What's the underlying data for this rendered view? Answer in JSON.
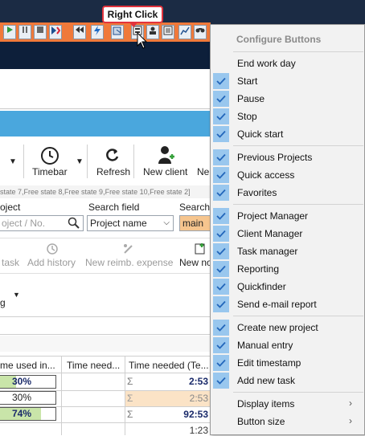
{
  "callout": {
    "label": "Right Click"
  },
  "ribbon": {
    "timebar": "Timebar",
    "refresh": "Refresh",
    "new_client": "New client",
    "new_cut": "Ne",
    "free_states": "state 7,Free state 8,Free state 9,Free state 10,Free state 2]",
    "search_field_label": "Search field",
    "search_label": "Search",
    "project_label": "oject",
    "project_placeholder": "oject / No.",
    "search_field_value": "Project name",
    "search_value": "main",
    "task_cut": "task",
    "add_history": "Add history",
    "new_reimb": "New reimb. expense",
    "new_no": "New no",
    "g_cut": "g"
  },
  "table": {
    "headers": [
      "me used in...",
      "Time need...",
      "Time needed (Te..."
    ],
    "rows": [
      {
        "pct": "30%",
        "pct_value": 0.3,
        "sigma": "Σ",
        "time": "2:53",
        "bold": true
      },
      {
        "pct": "30%",
        "pct_value": 0.0,
        "sigma": "Σ",
        "time": "2:53",
        "bold": false
      },
      {
        "pct": "74%",
        "pct_value": 0.74,
        "sigma": "Σ",
        "time": "92:53",
        "bold": true
      },
      {
        "pct": "",
        "pct_value": 0,
        "sigma": "",
        "time": "1:23",
        "bold": false
      }
    ]
  },
  "menu": {
    "title": "Configure Buttons",
    "items": [
      {
        "label": "End work day",
        "checked": false
      },
      {
        "label": "Start",
        "checked": true
      },
      {
        "label": "Pause",
        "checked": true
      },
      {
        "label": "Stop",
        "checked": true
      },
      {
        "label": "Quick start",
        "checked": true
      },
      {
        "label": "Previous Projects",
        "checked": true
      },
      {
        "label": "Quick access",
        "checked": true
      },
      {
        "label": "Favorites",
        "checked": true
      },
      {
        "label": "Project Manager",
        "checked": true
      },
      {
        "label": "Client Manager",
        "checked": true
      },
      {
        "label": "Task manager",
        "checked": true
      },
      {
        "label": "Reporting",
        "checked": true
      },
      {
        "label": "Quickfinder",
        "checked": true
      },
      {
        "label": "Send e-mail report",
        "checked": true
      },
      {
        "label": "Create new project",
        "checked": true
      },
      {
        "label": "Manual entry",
        "checked": true
      },
      {
        "label": "Edit timestamp",
        "checked": true
      },
      {
        "label": "Add new task",
        "checked": true
      },
      {
        "label": "Display items",
        "checked": false,
        "submenu": true
      },
      {
        "label": "Button size",
        "checked": false,
        "submenu": true
      }
    ],
    "submenu_arrow": "›"
  },
  "colors": {
    "accent_orange": "#f0793a",
    "dark_navy": "#1b2b44",
    "check_bg": "#99c7ee",
    "callout_red": "#e2333d",
    "band_blue": "#4aa7dd"
  },
  "icons": [
    "play-icon",
    "pause-icon",
    "stop-icon",
    "quick-start-icon",
    "previous-projects-icon",
    "quick-access-icon",
    "favorites-icon",
    "project-manager-icon",
    "client-manager-icon",
    "task-manager-icon",
    "reporting-icon",
    "quickfinder-icon",
    "checkmark-icon",
    "mouse-cursor-icon",
    "timebar-clock-icon",
    "refresh-icon",
    "new-client-icon",
    "search-icon",
    "chevron-down-icon"
  ]
}
